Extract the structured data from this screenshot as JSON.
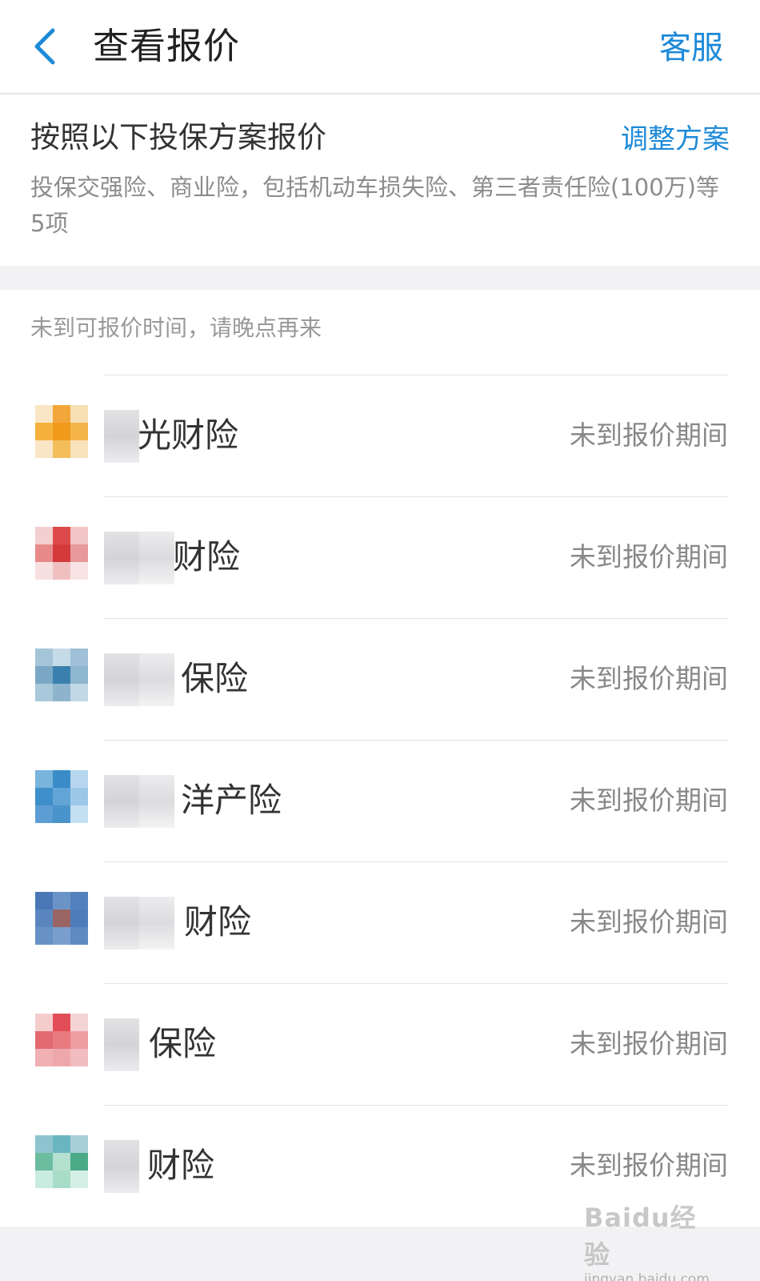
{
  "header": {
    "title": "查看报价",
    "service_label": "客服"
  },
  "plan": {
    "title": "按照以下投保方案报价",
    "adjust_label": "调整方案",
    "description": "投保交强险、商业险，包括机动车损失险、第三者责任险(100万)等5项"
  },
  "notice": "未到可报价时间，请晚点再来",
  "companies": [
    {
      "name": "光财险",
      "status": "未到报价期间",
      "logo_colors": [
        "#f8e6c4",
        "#f3a63a",
        "#f7dfb4",
        "#f5b13b",
        "#f29a1c",
        "#f4b44a",
        "#f9e6c6",
        "#f3be5a",
        "#f8e2bc"
      ]
    },
    {
      "name": "财险",
      "status": "未到报价期间",
      "logo_colors": [
        "#f4cfd0",
        "#dc4a4a",
        "#f2c6c6",
        "#e88a8a",
        "#d43a3a",
        "#e89a9a",
        "#f7e0e0",
        "#f0c0c0",
        "#f8e4e4"
      ]
    },
    {
      "name": "保险",
      "status": "未到报价期间",
      "logo_colors": [
        "#a4c4d8",
        "#c6dbe8",
        "#9fc0d6",
        "#7aa8c4",
        "#3a80ae",
        "#8fb6cf",
        "#a9c8db",
        "#8db4cc",
        "#c2d8e6"
      ]
    },
    {
      "name": "洋产险",
      "status": "未到报价期间",
      "logo_colors": [
        "#78b4dc",
        "#3a8cc8",
        "#b6d6ee",
        "#3f8fca",
        "#62a4d6",
        "#9cc8e8",
        "#5c9ed4",
        "#4a94cc",
        "#c4def2"
      ]
    },
    {
      "name": "财险",
      "status": "未到报价期间",
      "logo_colors": [
        "#4a78b6",
        "#6a94c8",
        "#5280bc",
        "#5a86c0",
        "#9a6464",
        "#4e7cb8",
        "#6892c6",
        "#7a9ece",
        "#5e8ac2"
      ]
    },
    {
      "name": "保险",
      "status": "未到报价期间",
      "logo_colors": [
        "#f4cccc",
        "#e24e58",
        "#f5d4d6",
        "#e46a72",
        "#e87a80",
        "#ee9ca0",
        "#f0b0b4",
        "#eea8ac",
        "#f2bcc0"
      ]
    },
    {
      "name": "财险",
      "status": "未到报价期间",
      "logo_colors": [
        "#8ec4d0",
        "#6ab6c0",
        "#a6cfd8",
        "#6cbca0",
        "#b4e0d0",
        "#4aaa88",
        "#c8ece0",
        "#a8dcc8",
        "#d4f0e6"
      ]
    }
  ],
  "watermark": {
    "brand": "Bai du 经验",
    "url": "jingyan.baidu.com"
  }
}
